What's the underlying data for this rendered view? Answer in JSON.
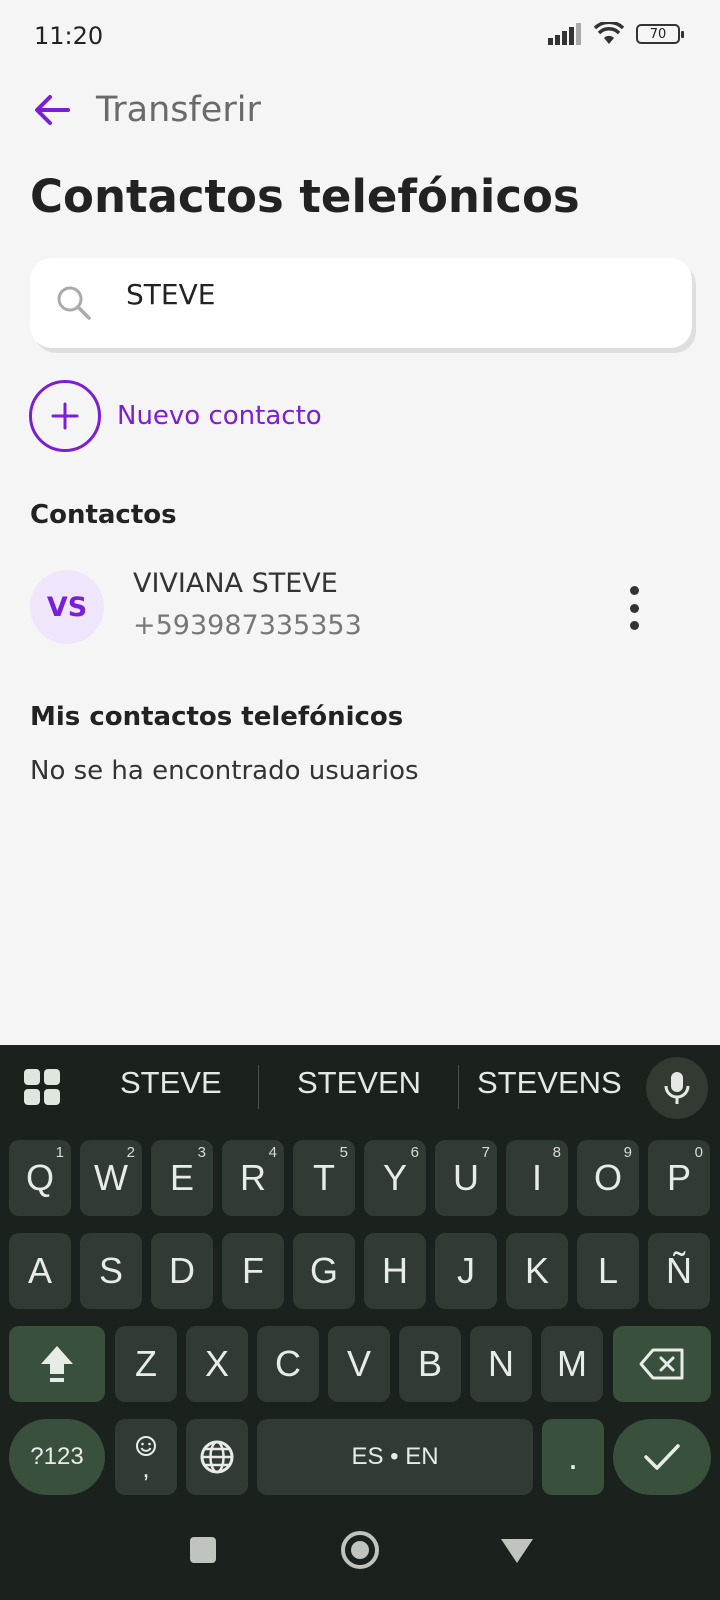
{
  "status_bar": {
    "time": "11:20",
    "battery": "70"
  },
  "header": {
    "nav_title": "Transferir",
    "page_title": "Contactos telefónicos"
  },
  "search": {
    "value": "STEVE",
    "icon": "search-icon"
  },
  "new_contact": {
    "label": "Nuevo contacto"
  },
  "contacts": {
    "heading": "Contactos",
    "items": [
      {
        "initials": "VS",
        "name": "VIVIANA STEVE",
        "phone": "+593987335353"
      }
    ]
  },
  "phone_contacts": {
    "heading": "Mis contactos telefónicos",
    "empty": "No se ha encontrado usuarios"
  },
  "keyboard": {
    "suggestions": [
      "STEVE",
      "STEVEN",
      "STEVENS"
    ],
    "row1": [
      {
        "k": "Q",
        "n": "1"
      },
      {
        "k": "W",
        "n": "2"
      },
      {
        "k": "E",
        "n": "3"
      },
      {
        "k": "R",
        "n": "4"
      },
      {
        "k": "T",
        "n": "5"
      },
      {
        "k": "Y",
        "n": "6"
      },
      {
        "k": "U",
        "n": "7"
      },
      {
        "k": "I",
        "n": "8"
      },
      {
        "k": "O",
        "n": "9"
      },
      {
        "k": "P",
        "n": "0"
      }
    ],
    "row2": [
      "A",
      "S",
      "D",
      "F",
      "G",
      "H",
      "J",
      "K",
      "L",
      "Ñ"
    ],
    "row3": [
      "Z",
      "X",
      "C",
      "V",
      "B",
      "N",
      "M"
    ],
    "symbols_label": "?123",
    "emoji_comma": ",",
    "space_label": "ES • EN",
    "period": "."
  },
  "colors": {
    "accent": "#7b1fd6",
    "keyboard_bg": "#1b211c",
    "key_bg": "#323b33",
    "func_key_bg": "#38503c"
  }
}
